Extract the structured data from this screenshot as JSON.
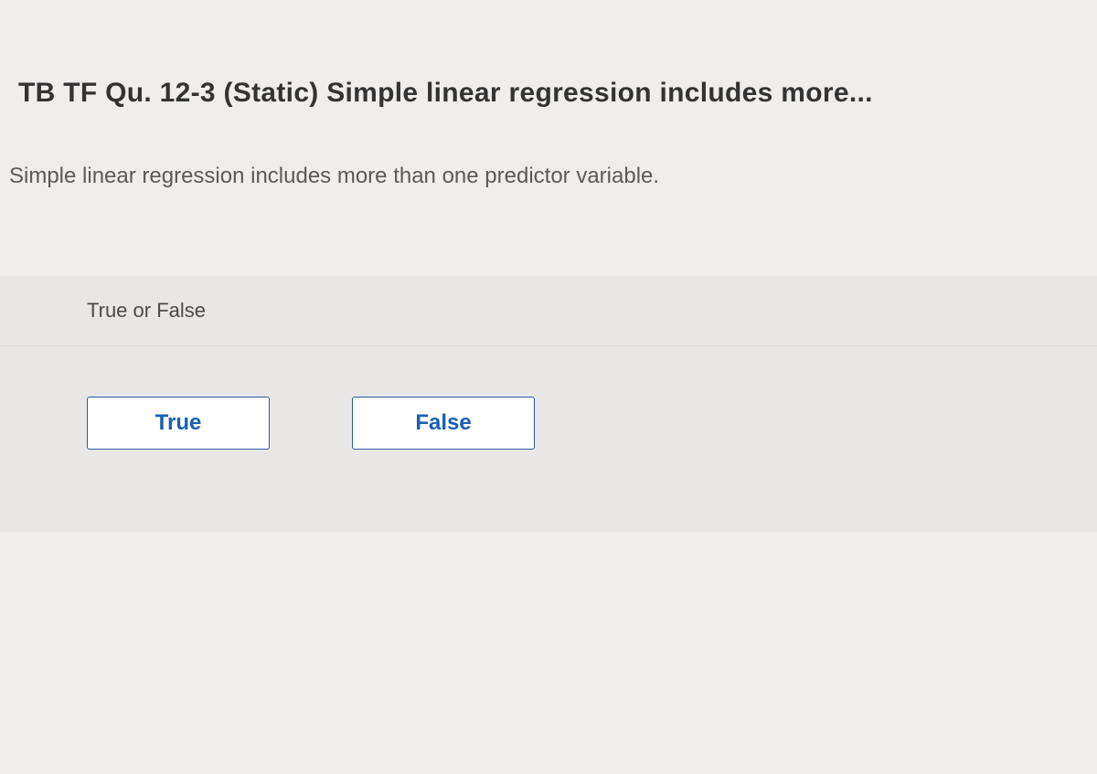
{
  "question": {
    "title": "TB TF Qu. 12-3 (Static) Simple linear regression includes more...",
    "text": "Simple linear regression includes more than one predictor variable.",
    "prompt": "True or False"
  },
  "options": {
    "true_label": "True",
    "false_label": "False"
  }
}
